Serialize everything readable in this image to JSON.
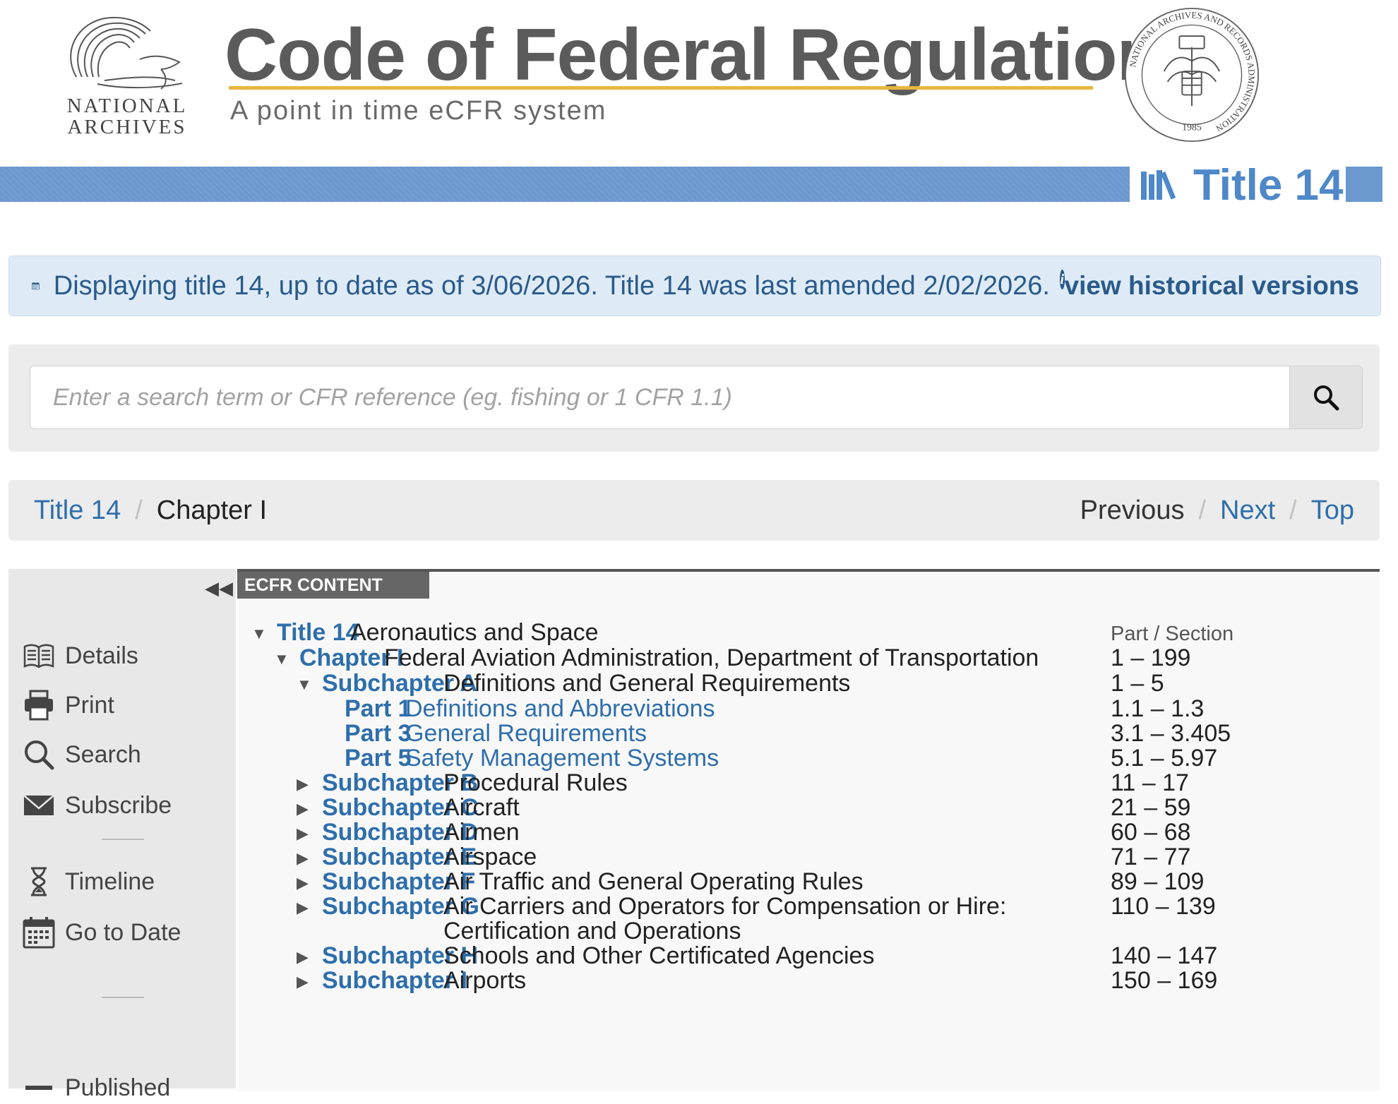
{
  "header": {
    "logo_text_line1": "NATIONAL",
    "logo_text_line2": "ARCHIVES",
    "title": "Code of Federal Regulations",
    "tagline": "A point in time eCFR system",
    "seal_text": "NATIONAL ARCHIVES AND RECORDS ADMINISTRATION 1985",
    "title_chip": "Title 14",
    "colors": {
      "banner": "#6b98cf",
      "title_rule": "#e8b53f",
      "link": "#2e6eab"
    }
  },
  "infobar": {
    "text": "Displaying title 14, up to date as of 3/06/2026. Title 14 was last amended 2/02/2026.",
    "info_icon": "i",
    "history_link": "view historical versions"
  },
  "search": {
    "placeholder": "Enter a search term or CFR reference (eg. fishing or 1 CFR 1.1)",
    "value": ""
  },
  "breadcrumb": {
    "items": [
      "Title 14",
      "Chapter I"
    ],
    "separator": "/",
    "previous": "Previous",
    "next": "Next",
    "top": "Top"
  },
  "sidebar": {
    "collapse_icon": "◀◀",
    "items": [
      {
        "label": "Details",
        "icon": "book-icon"
      },
      {
        "label": "Print",
        "icon": "printer-icon"
      },
      {
        "label": "Search",
        "icon": "search-icon"
      },
      {
        "label": "Subscribe",
        "icon": "envelope-icon"
      },
      {
        "label": "Timeline",
        "icon": "hourglass-icon"
      },
      {
        "label": "Go to Date",
        "icon": "calendar-icon"
      },
      {
        "label": "Published",
        "icon": "published-icon"
      }
    ]
  },
  "content": {
    "tab": "ECFR CONTENT",
    "column_header": "Part / Section",
    "rows": [
      {
        "toggle": "▼",
        "label": "Title 14",
        "desc": "Aeronautics and Space",
        "range": ""
      },
      {
        "toggle": "▼",
        "label": "Chapter I",
        "desc": "Federal Aviation Administration, Department of Transportation",
        "range": "1 – 199"
      },
      {
        "toggle": "▼",
        "label": "Subchapter A",
        "desc": "Definitions and General Requirements",
        "range": "1 – 5"
      },
      {
        "toggle": "",
        "label": "Part 1",
        "desc": "Definitions and Abbreviations",
        "range": "1.1 – 1.3"
      },
      {
        "toggle": "",
        "label": "Part 3",
        "desc": "General Requirements",
        "range": "3.1 – 3.405"
      },
      {
        "toggle": "",
        "label": "Part 5",
        "desc": "Safety Management Systems",
        "range": "5.1 – 5.97"
      },
      {
        "toggle": "▶",
        "label": "Subchapter B",
        "desc": "Procedural Rules",
        "range": "11 – 17"
      },
      {
        "toggle": "▶",
        "label": "Subchapter C",
        "desc": "Aircraft",
        "range": "21 – 59"
      },
      {
        "toggle": "▶",
        "label": "Subchapter D",
        "desc": "Airmen",
        "range": "60 – 68"
      },
      {
        "toggle": "▶",
        "label": "Subchapter E",
        "desc": "Airspace",
        "range": "71 – 77"
      },
      {
        "toggle": "▶",
        "label": "Subchapter F",
        "desc": "Air Traffic and General Operating Rules",
        "range": "89 – 109"
      },
      {
        "toggle": "▶",
        "label": "Subchapter G",
        "desc": "Air Carriers and Operators for Compensation or Hire:",
        "desc2": "Certification and Operations",
        "range": "110 – 139"
      },
      {
        "toggle": "▶",
        "label": "Subchapter H",
        "desc": "Schools and Other Certificated Agencies",
        "range": "140 – 147"
      },
      {
        "toggle": "▶",
        "label": "Subchapter I",
        "desc": "Airports",
        "range": "150 – 169"
      }
    ]
  }
}
